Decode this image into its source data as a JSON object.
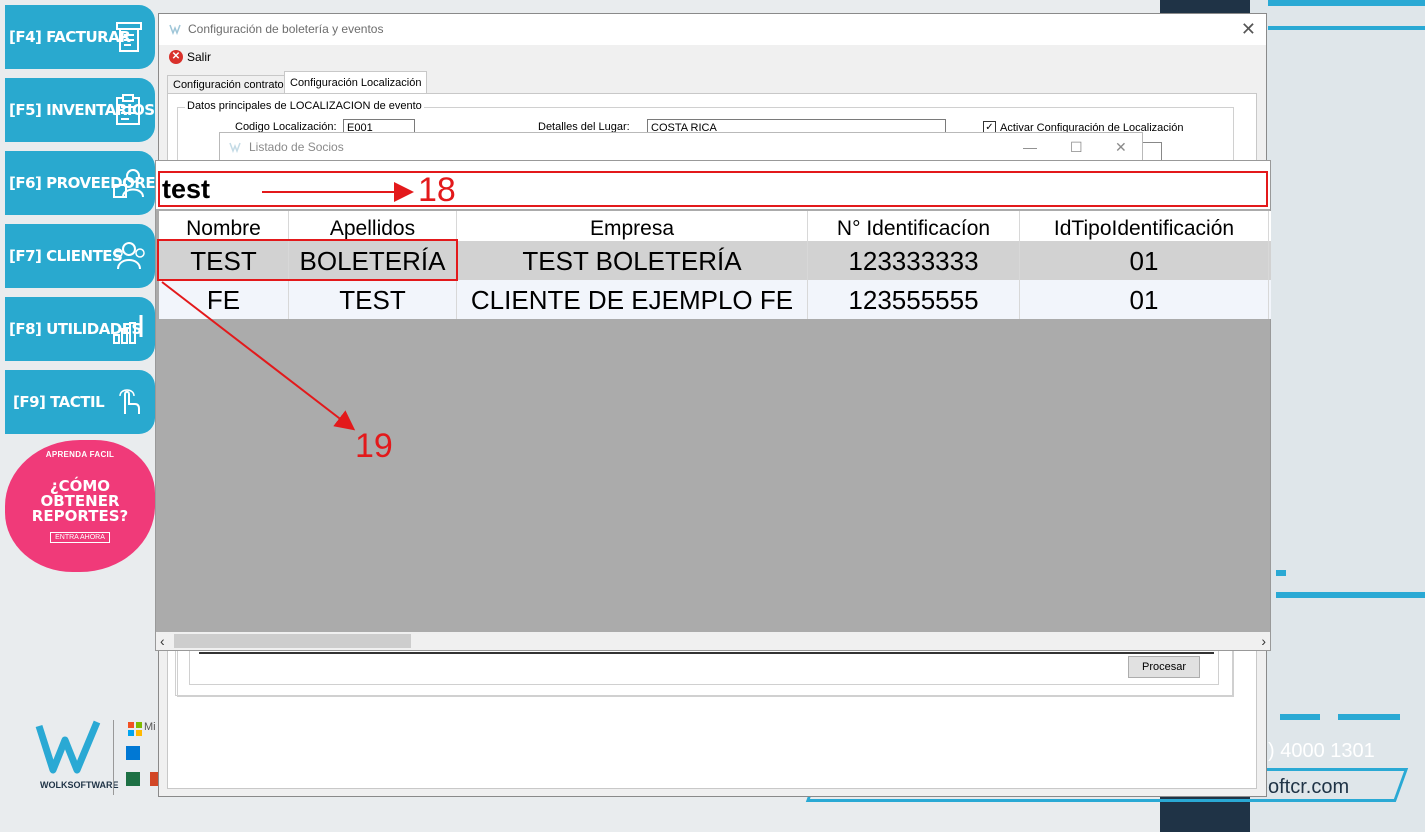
{
  "background": {
    "phone": ") 4000 1301",
    "web": "oftcr.com",
    "colors": {
      "brand_blue": "#29a9cf",
      "navy": "#1f3346",
      "promo_pink": "#f03a79",
      "annotation_red": "#e3191b"
    }
  },
  "dock": {
    "items": [
      {
        "label": "[F4] FACTURAR",
        "icon": "cash-register-icon"
      },
      {
        "label": "[F5] INVENTARIOS",
        "icon": "clipboard-list-icon"
      },
      {
        "label": "[F6] PROVEEDORES",
        "icon": "supplier-icon"
      },
      {
        "label": "[F7] CLIENTES",
        "icon": "users-icon"
      },
      {
        "label": "[F8] UTILIDADES",
        "icon": "tools-chart-icon"
      },
      {
        "label": "[F9] TACTIL",
        "icon": "touch-hand-icon"
      }
    ],
    "promo": {
      "small": "APRENDA FACIL",
      "line1": "¿CÓMO",
      "line2": "OBTENER",
      "line3": "REPORTES?",
      "cta": "ENTRA AHORA"
    },
    "logo_text": "WOLKSOFTWARE",
    "partner_text": "Mi"
  },
  "main_window": {
    "title": "Configuración de boletería y eventos",
    "salir": "Salir",
    "tabs": [
      {
        "label": "Configuración contrato",
        "active": false
      },
      {
        "label": "Configuración Localización",
        "active": true
      }
    ],
    "group_title": "Datos principales de LOCALIZACION de evento",
    "codigo_label": "Codigo Localización:",
    "codigo_value": "E001",
    "detalles_label": "Detalles del Lugar:",
    "detalles_value": "COSTA RICA",
    "activar_label": "Activar Configuración de Localización",
    "activar_checked": true,
    "procesar": "Procesar"
  },
  "socios_dialog": {
    "title": "Listado de Socios",
    "search_value": "test",
    "columns": [
      "Nombre",
      "Apellidos",
      "Empresa",
      "N° Identificacíon",
      "IdTipoIdentificación"
    ],
    "rows": [
      [
        "TEST",
        "BOLETERÍA",
        "TEST BOLETERÍA",
        "123333333",
        "01"
      ],
      [
        "FE",
        "TEST",
        "CLIENTE DE EJEMPLO FE",
        "123555555",
        "01"
      ]
    ]
  },
  "annotations": {
    "step_18": "18",
    "step_19": "19"
  }
}
